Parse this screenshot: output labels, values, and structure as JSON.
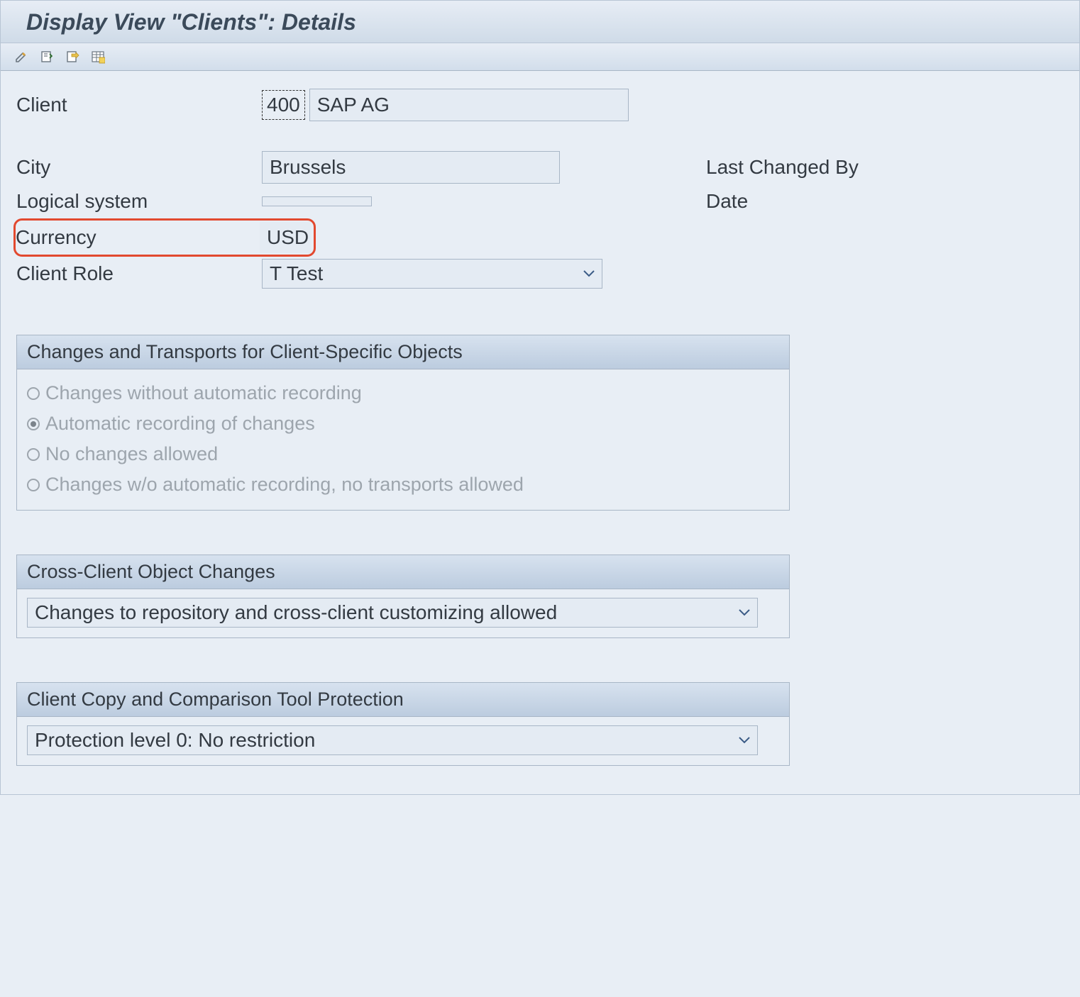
{
  "title": "Display View \"Clients\": Details",
  "toolbar": {
    "edit": "Edit",
    "copy": "Copy",
    "export": "Export",
    "table_settings": "Table Settings"
  },
  "fields": {
    "client_label": "Client",
    "client_number": "400",
    "client_name": "SAP AG",
    "city_label": "City",
    "city": "Brussels",
    "logical_system_label": "Logical system",
    "logical_system": "",
    "currency_label": "Currency",
    "currency": "USD",
    "client_role_label": "Client Role",
    "client_role": "T  Test",
    "last_changed_by_label": "Last Changed By",
    "date_label": "Date"
  },
  "group_changes": {
    "title": "Changes and Transports for Client-Specific Objects",
    "options": [
      "Changes without automatic recording",
      "Automatic recording of changes",
      "No changes allowed",
      "Changes w/o automatic recording, no transports allowed"
    ],
    "selected_index": 1
  },
  "group_cross_client": {
    "title": "Cross-Client Object Changes",
    "value": "Changes to repository and cross-client customizing allowed"
  },
  "group_protection": {
    "title": "Client Copy and Comparison Tool Protection",
    "value": "Protection level 0: No restriction"
  }
}
